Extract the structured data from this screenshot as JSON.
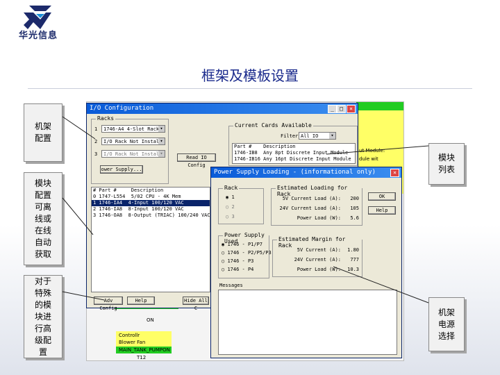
{
  "logo": {
    "text": "华光信息"
  },
  "slide": {
    "title": "框架及模板设置"
  },
  "callouts": {
    "rack_config": "机架配置",
    "module_list": "模块列表",
    "offline_online": "模块配置可离线或在线自动获取",
    "special_modules": "对于特殊的模块进行高级配置",
    "rack_power": "机架电源选择"
  },
  "io_window": {
    "title": "I/O Configuration",
    "racks_label": "Racks",
    "rack_rows": [
      {
        "num": "1",
        "value": "1746-A4  4-Slot Rack"
      },
      {
        "num": "2",
        "value": "I/O Rack Not Installe"
      },
      {
        "num": "3",
        "value": "I/O Rack Not Installe"
      }
    ],
    "read_io_button": "Read IO Config",
    "power_supply_button": "ower Supply...",
    "current_cards_label": "Current Cards Available",
    "filter_label": "Filter",
    "filter_value": "All IO",
    "cards_headers": [
      "Part #",
      "Description"
    ],
    "cards_rows": [
      {
        "part": "1746-IB8",
        "desc": "Any 8pt  Discrete Input Module"
      },
      {
        "part": "1746-IB16",
        "desc": "Any 16pt Discrete Input Module"
      }
    ],
    "module_headers": [
      "# Part #",
      "Description"
    ],
    "module_rows": [
      {
        "part": "0  1747-L554",
        "desc": "5/02 CPU - 4K Mem"
      },
      {
        "part": "1  1746-IA4",
        "desc": "4-Input 100/120 VAC"
      },
      {
        "part": "2  1746-IA8",
        "desc": "8-Input 100/120 VAC"
      },
      {
        "part": "3  1746-OA8",
        "desc": "8-Output (TRIAC) 100/240 VAC"
      }
    ],
    "adv_config_button": "Adv Config",
    "help_button": "Help",
    "hide_all_button": "Hide All C"
  },
  "power_window": {
    "title": "Power Supply Loading - (informational only)",
    "rack_label": "Rack",
    "rack_options": [
      "1",
      "2",
      "3"
    ],
    "est_loading_label": "Estimated Loading for Rack",
    "est_rows": [
      {
        "label": "5V Current Load (A):",
        "value": "200"
      },
      {
        "label": "24V Current Load (A):",
        "value": "105"
      },
      {
        "label": "Power Load (W):",
        "value": "5.6"
      }
    ],
    "ok_button": "OK",
    "help_button": "Help",
    "ps_used_label": "Power Supply Used",
    "ps_options": [
      "1746 - P1/P7",
      "1746 - P2/P5/P3",
      "1746 - P3",
      "1746 - P4"
    ],
    "est_margin_label": "Estimated Margin for Rack",
    "margin_rows": [
      {
        "label": "5V Current (A):",
        "value": "1.80"
      },
      {
        "label": "24V Current (A):",
        "value": "777"
      },
      {
        "label": "Power Load (W):",
        "value": "10.3"
      }
    ],
    "messages_label": "Messages"
  },
  "background_fragments": {
    "right_text_1": "ut Module:",
    "right_text_2": "dule wit",
    "status_on": "ON",
    "legend_1": "Controllr",
    "legend_2": "Blower Fan",
    "legend_3": "MAIN_TANK_PUMPON",
    "bottom_num": "T12"
  },
  "colors": {
    "accent": "#1a2a8c",
    "titlebar": "#0a5bd8",
    "highlight_green": "#22cc22",
    "highlight_yellow": "#ffff66"
  }
}
